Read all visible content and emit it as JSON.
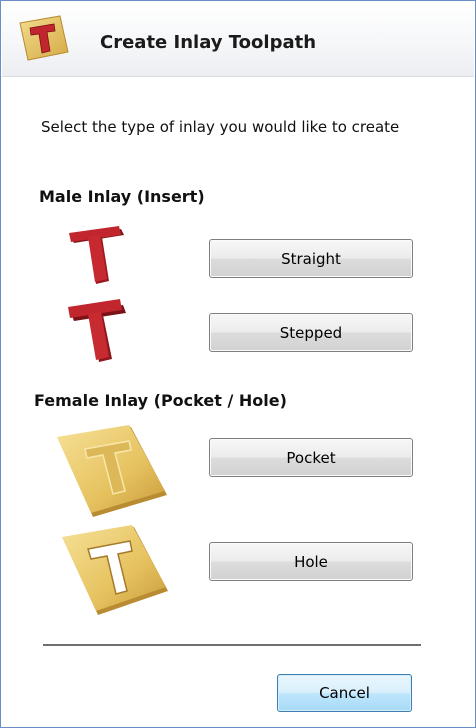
{
  "dialog": {
    "title": "Create Inlay Toolpath",
    "header_icon": "t-inlay-logo-icon"
  },
  "intro": "Select the type of inlay you would like to create",
  "male": {
    "heading": "Male Inlay (Insert)",
    "straight_label": "Straight",
    "stepped_label": "Stepped",
    "straight_image": "red-t-straight-icon",
    "stepped_image": "red-t-stepped-icon"
  },
  "female": {
    "heading": "Female Inlay (Pocket / Hole)",
    "pocket_label": "Pocket",
    "hole_label": "Hole",
    "pocket_image": "gold-plate-pocket-icon",
    "hole_image": "gold-plate-hole-icon"
  },
  "footer": {
    "cancel_label": "Cancel"
  },
  "colors": {
    "red_t": "#b3222a",
    "gold_plate": "#e9c764",
    "border": "#6a8fc7"
  }
}
